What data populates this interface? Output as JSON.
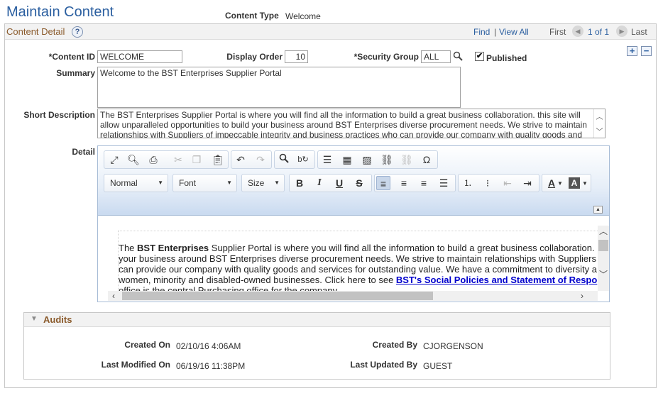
{
  "page": {
    "title": "Maintain Content"
  },
  "content_type": {
    "label": "Content Type",
    "value": "Welcome"
  },
  "detail": {
    "title": "Content Detail",
    "help": "?",
    "nav": {
      "find": "Find",
      "sep": "|",
      "view_all": "View All",
      "first": "First",
      "count": "1 of 1",
      "last": "Last"
    },
    "add": "+",
    "delete": "−"
  },
  "fields": {
    "content_id": {
      "label": "*Content ID",
      "value": "WELCOME"
    },
    "display_order": {
      "label": "Display Order",
      "value": "10"
    },
    "security_group": {
      "label": "*Security Group",
      "value": "ALL"
    },
    "published": {
      "label": "Published",
      "checked": true,
      "mark": "✔"
    },
    "summary": {
      "label": "Summary",
      "value": "Welcome to the BST Enterprises Supplier Portal"
    },
    "short_description": {
      "label": "Short Description",
      "value": "The BST Enterprises Supplier Portal is where you will find all the information to build a great business collaboration.  this site will allow unparalleled opportunities to build your business around BST Enterprises diverse procurement needs.  We strive to maintain relationships with Suppliers of impeccable integrity and business practices who can provide our company with quality goods and"
    },
    "detail": {
      "label": "Detail"
    }
  },
  "editor": {
    "toolbar_icons": [
      "maximize-icon",
      "preview-icon",
      "print-icon",
      "cut-icon",
      "copy-icon",
      "paste-icon",
      "undo-icon",
      "redo-icon",
      "find-icon",
      "replace-icon",
      "horizontal-line-icon",
      "table-icon",
      "image-icon",
      "link-icon",
      "unlink-icon",
      "special-char-icon"
    ],
    "format_combo": "Normal",
    "font_combo": "Font",
    "size_combo": "Size",
    "bold": "B",
    "italic": "I",
    "underline": "U",
    "strike": "S",
    "special_char": "Ω",
    "text_color": "A",
    "bg_color": "A",
    "content": {
      "line1_pre": "The ",
      "line1_bold": "BST Enterprises",
      "line1_post": " Supplier Portal is where you will find all the information to build a great business collaboration.",
      "line2": "your business around BST Enterprises diverse procurement needs.  We strive to maintain relationships with Suppliers",
      "line3": "can provide our company with quality goods and services for outstanding value. We have a commitment to diversity a",
      "line4_pre": "women, minority and disabled-owned businesses.  Click here to see ",
      "line4_link": "BST's Social Policies and Statement of Respo",
      "line5": "office is the central Purchasing office for the company."
    }
  },
  "audits": {
    "title": "Audits",
    "created_on": {
      "label": "Created On",
      "value": "02/10/16  4:06AM"
    },
    "created_by": {
      "label": "Created By",
      "value": "CJORGENSON"
    },
    "last_modified_on": {
      "label": "Last Modified On",
      "value": "06/19/16 11:38PM"
    },
    "last_updated_by": {
      "label": "Last Updated By",
      "value": "GUEST"
    }
  }
}
